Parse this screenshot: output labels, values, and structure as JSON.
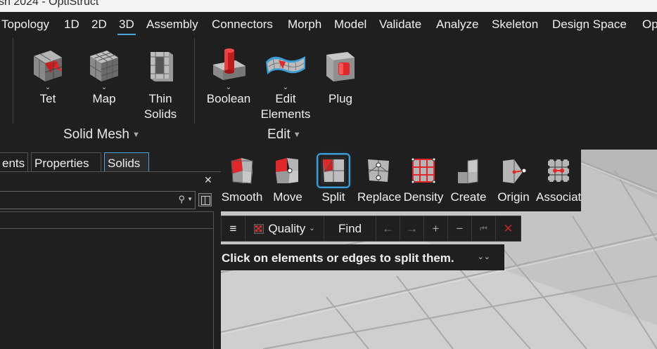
{
  "window": {
    "title": "sh 2024 - OptiStruct"
  },
  "menubar": {
    "items": [
      {
        "label": "Topology"
      },
      {
        "label": "1D"
      },
      {
        "label": "2D"
      },
      {
        "label": "3D"
      },
      {
        "label": "Assembly"
      },
      {
        "label": "Connectors"
      },
      {
        "label": "Morph"
      },
      {
        "label": "Model"
      },
      {
        "label": "Validate"
      },
      {
        "label": "Analyze"
      },
      {
        "label": "Skeleton"
      },
      {
        "label": "Design Space"
      },
      {
        "label": "Op"
      }
    ],
    "active": "3D"
  },
  "ribbon": {
    "solid_mesh_group": "Solid Mesh",
    "edit_group": "Edit",
    "tools": {
      "tet": {
        "label": "Tet",
        "icon": "tet-mesh-icon"
      },
      "map": {
        "label": "Map",
        "icon": "map-mesh-icon"
      },
      "thin": {
        "label": "Thin",
        "label2": "Solids",
        "icon": "thin-solids-icon"
      },
      "boolean": {
        "label": "Boolean",
        "icon": "boolean-icon"
      },
      "edit": {
        "label": "Edit",
        "label2": "Elements",
        "icon": "edit-elements-icon"
      },
      "plug": {
        "label": "Plug",
        "icon": "plug-icon"
      }
    }
  },
  "browser": {
    "tabs": [
      {
        "label": "ents"
      },
      {
        "label": "Properties"
      },
      {
        "label": "Solids"
      }
    ],
    "active_tab": "Solids",
    "search_placeholder": ""
  },
  "edit_toolbar": {
    "tools": [
      {
        "label": "Smooth"
      },
      {
        "label": "Move"
      },
      {
        "label": "Split"
      },
      {
        "label": "Replace"
      },
      {
        "label": "Density"
      },
      {
        "label": "Create"
      },
      {
        "label": "Origin"
      },
      {
        "label": "Associat"
      }
    ],
    "active": "Split"
  },
  "findbar": {
    "menu_icon": "≡",
    "quality_label": "Quality",
    "find_label": "Find",
    "prev_icon": "←",
    "next_icon": "→",
    "add_icon": "+",
    "remove_icon": "−",
    "reset_icon": "⏮",
    "clear_icon": "✕"
  },
  "hint": {
    "text": "Click on elements or edges to split them."
  },
  "colors": {
    "accent": "#4aa3d9",
    "red": "#e0282a",
    "panel": "#1f1f1f",
    "viewport": "#c8c8c8"
  }
}
